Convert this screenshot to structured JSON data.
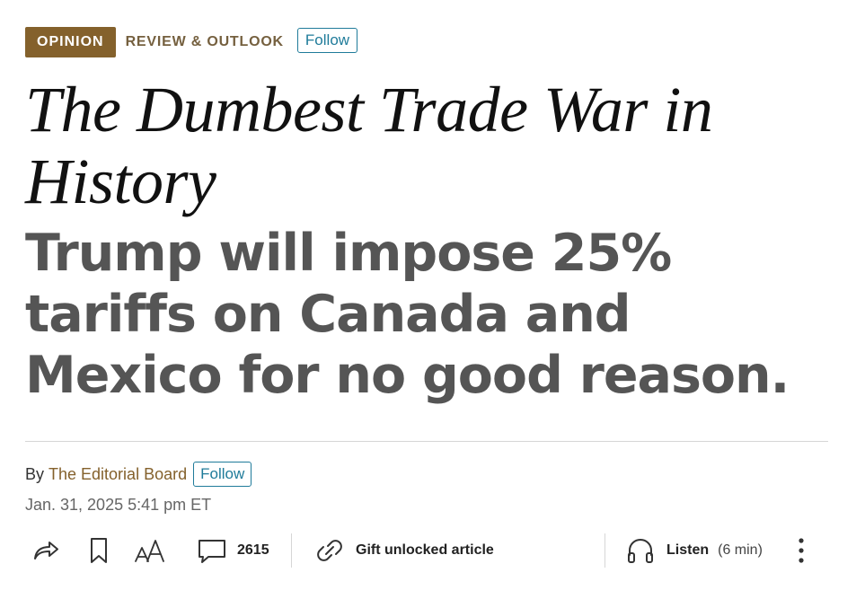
{
  "header": {
    "section_badge": "OPINION",
    "section_name": "REVIEW & OUTLOOK",
    "follow_label": "Follow"
  },
  "article": {
    "headline": "The Dumbest Trade War in History",
    "dek": "Trump will impose 25% tariffs on Canada and Mexico for no good reason.",
    "byline_prefix": "By",
    "author": "The Editorial Board",
    "author_follow_label": "Follow",
    "timestamp": "Jan. 31, 2025 5:41 pm ET"
  },
  "toolbar": {
    "share_icon": "share-icon",
    "bookmark_icon": "bookmark-icon",
    "text_size_icon": "text-size-icon",
    "comments_icon": "comment-icon",
    "comment_count": "2615",
    "gift_icon": "gift-link-icon",
    "gift_label": "Gift unlocked article",
    "listen_icon": "headphones-icon",
    "listen_label": "Listen",
    "listen_duration": "(6 min)",
    "more_icon": "more-vertical-icon"
  },
  "colors": {
    "opinion_badge": "#84612c",
    "section_text": "#75603f",
    "follow_accent": "#1f7b9a",
    "headline": "#111111",
    "dek": "#555555",
    "timestamp": "#666666"
  }
}
